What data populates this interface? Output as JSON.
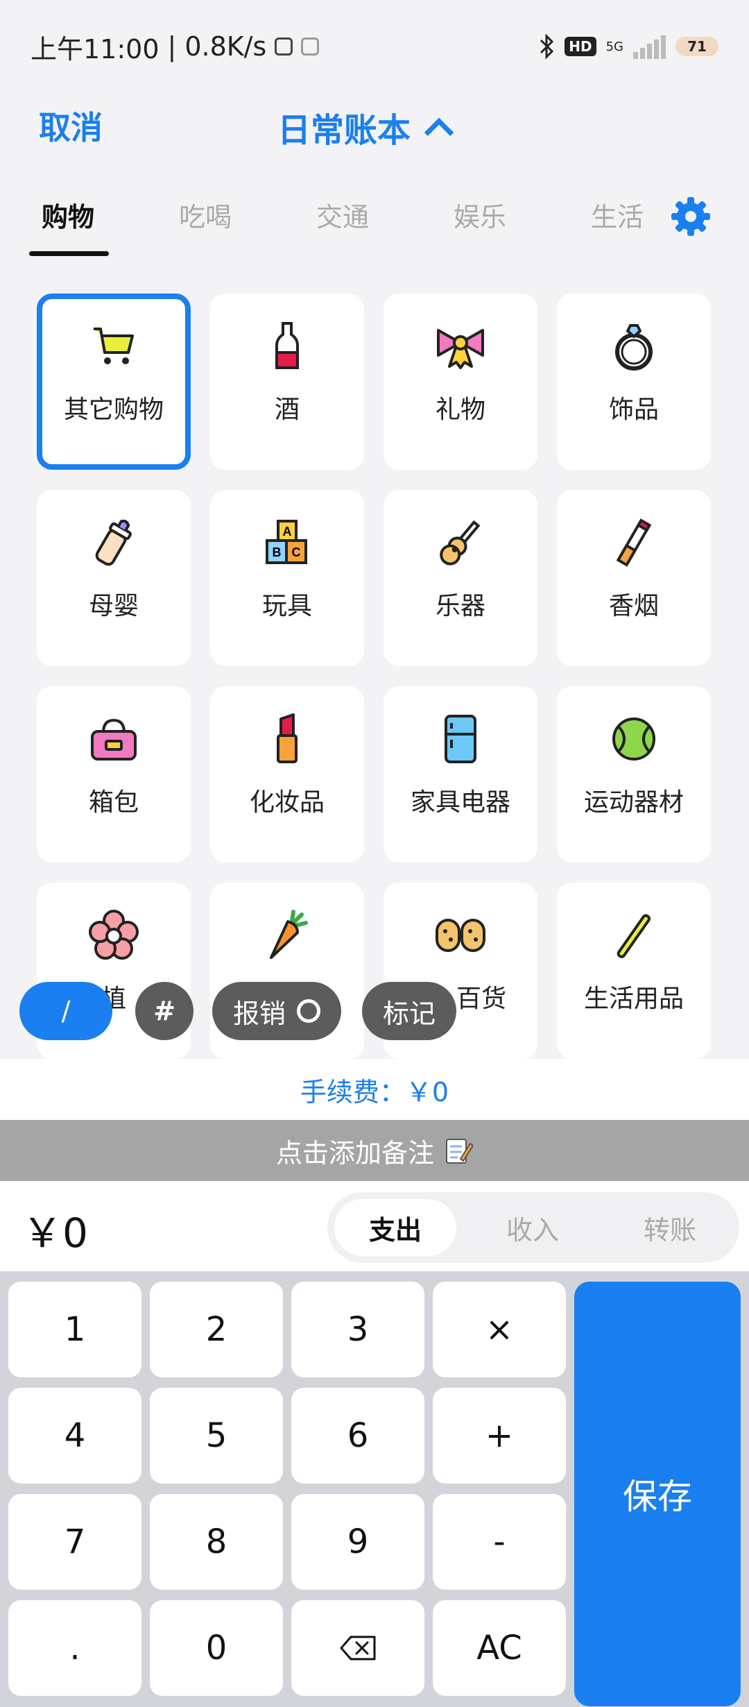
{
  "status_bar": {
    "time": "上午11:00",
    "speed": "0.8K/s",
    "network": "5G",
    "hd": "HD",
    "battery": "71"
  },
  "header": {
    "cancel_label": "取消",
    "book_title": "日常账本"
  },
  "tabs": [
    {
      "label": "购物",
      "active": true
    },
    {
      "label": "吃喝",
      "active": false
    },
    {
      "label": "交通",
      "active": false
    },
    {
      "label": "娱乐",
      "active": false
    },
    {
      "label": "生活",
      "active": false
    }
  ],
  "categories": [
    {
      "label": "其它购物",
      "icon": "shopping-cart-icon",
      "selected": true
    },
    {
      "label": "酒",
      "icon": "wine-bottle-icon"
    },
    {
      "label": "礼物",
      "icon": "gift-bow-icon"
    },
    {
      "label": "饰品",
      "icon": "ring-icon"
    },
    {
      "label": "母婴",
      "icon": "baby-bottle-icon"
    },
    {
      "label": "玩具",
      "icon": "toy-blocks-icon"
    },
    {
      "label": "乐器",
      "icon": "guitar-icon"
    },
    {
      "label": "香烟",
      "icon": "cigarette-icon"
    },
    {
      "label": "箱包",
      "icon": "handbag-icon"
    },
    {
      "label": "化妆品",
      "icon": "lipstick-icon"
    },
    {
      "label": "家具电器",
      "icon": "fridge-icon"
    },
    {
      "label": "运动器材",
      "icon": "tennis-ball-icon"
    },
    {
      "label": "植",
      "icon": "flower-icon"
    },
    {
      "label": "",
      "icon": "carrot-icon"
    },
    {
      "label": "百货",
      "icon": "food-icon"
    },
    {
      "label": "生活用品",
      "icon": "toothbrush-icon"
    }
  ],
  "chips": {
    "slash": "/",
    "hash": "#",
    "reimburse": "报销",
    "mark": "标记"
  },
  "fee_text": "手续费：￥0",
  "note_text": "点击添加备注",
  "amount": "￥0",
  "type_segments": [
    {
      "label": "支出",
      "active": true
    },
    {
      "label": "收入",
      "active": false
    },
    {
      "label": "转账",
      "active": false
    }
  ],
  "keypad": {
    "keys": [
      "1",
      "2",
      "3",
      "×",
      "4",
      "5",
      "6",
      "+",
      "7",
      "8",
      "9",
      "-",
      ".",
      "0",
      "⌫",
      "AC"
    ],
    "save_label": "保存"
  },
  "colors": {
    "accent": "#1a7ff0",
    "chip_dark": "#5c5c5c",
    "note_bar": "#a5a5a5",
    "keypad_bg": "#d3d4d9"
  }
}
